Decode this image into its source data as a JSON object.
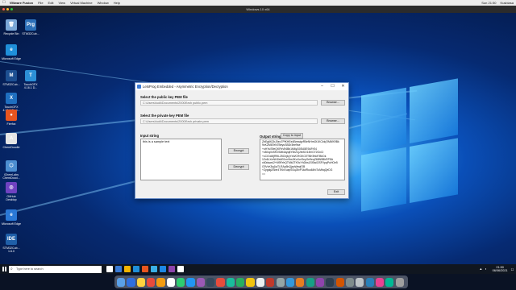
{
  "mac_menubar": {
    "app": "VMware Fusion",
    "menus": [
      "File",
      "Edit",
      "View",
      "Virtual Machine",
      "Window",
      "Help"
    ],
    "status": [
      "Sun 21:50",
      "Kusbiasa"
    ]
  },
  "vm_title": "Windows 10 x64",
  "desktop_icons": [
    {
      "label": "Recycle Bin",
      "glyph": "🗑",
      "color": "#7aa7d6"
    },
    {
      "label": "STM32Cub...",
      "glyph": "Prg",
      "color": "#2c6fb7"
    },
    {
      "label": "Microsoft Edge",
      "glyph": "e",
      "color": "#1f8fd9"
    },
    {
      "label": "STM32Cub...",
      "glyph": "M",
      "color": "#1d4f91"
    },
    {
      "label": "TouchGFX 4.16.1 D...",
      "glyph": "T",
      "color": "#2c8fd6"
    },
    {
      "label": "TouchGFX 4.16.1 Envi...",
      "glyph": "X",
      "color": "#1f6fc0"
    },
    {
      "label": "Firefox",
      "glyph": "●",
      "color": "#e8551f"
    },
    {
      "label": "ChemDoodle",
      "glyph": "A",
      "color": "#e6e6e6"
    },
    {
      "label": "iChemLabs ChemDood...",
      "glyph": "⬡",
      "color": "#4c8ed0"
    },
    {
      "label": "GitHub Desktop",
      "glyph": "◎",
      "color": "#6f42c1"
    },
    {
      "label": "Microsoft Edge",
      "glyph": "e",
      "color": "#2a78d6"
    },
    {
      "label": "STM32Cub... 1.6.0",
      "glyph": "IDE",
      "color": "#1f5fa8"
    }
  ],
  "app": {
    "title": "LetsProg Embedded - Asymmetric Encryption/Decryption",
    "window_controls": [
      "–",
      "☐",
      "✕"
    ],
    "public_key": {
      "label": "Select the public key PEM file",
      "path": "C:\\Users\\kuld\\Documents\\20008\\rsh public.pem",
      "browse": "Browse..."
    },
    "private_key": {
      "label": "Select the private key PEM file",
      "path": "C:\\Users\\kuld\\Documents\\20008\\rsh private.pem",
      "browse": "Browse..."
    },
    "input_label": "Input string",
    "input_value": "this is a sample text",
    "encrypt": "Encrypt",
    "decrypt": "Decrypt",
    "output_label": "Output string",
    "copy_to_input": "Copy to input",
    "output_lines": [
      "ZbEg6KZbJ0eo7PfKHEe4BmwigrR5eNHmOt1KCblq7lM6fX9Bk",
      "9xKZM6TeN7BeyuSBDr3ee9se",
      "+oHYuS9eQKFbVlf4Bb1M6yD0EA5E9AFrE4",
      "+cBXq0xSRJSMt4dyq8YBr2Cj2tbSO1BVO72GnCl",
      "+cCIGxMjR9lL25ChjbyYxWCRGKCETBK9hM7BhDk",
      "1Zc6LXeNHZekE0vnVbs3KoXcrSeyOe9eqZ68N5BhRP5A",
      "x60dswcl2+M99YeQTMb2TK9cYhDbs1Sf3wiOSFVpqPuHOe5",
      "G9VcK5q1iaTLRAp5hQjaoWeqfOB",
      "+Zygdg2Sbe4TKbXuzpSSqJ5vP1kdRuu64hI7uMbqQeDG",
      "=="
    ],
    "exit": "Exit"
  },
  "taskbar": {
    "search_placeholder": "Type here to search",
    "time": "21:50",
    "date": "06/06/2021",
    "icon_colors": [
      "#ffffff",
      "#3a7bd5",
      "#f4b400",
      "#1f8fd9",
      "#e8551f",
      "#3ab0e6",
      "#1e88e5",
      "#8e44ad",
      "#ffffff"
    ]
  },
  "dock": {
    "icon_colors": [
      "#5aa0e8",
      "#2f6fdf",
      "#ffd23f",
      "#e94b3c",
      "#f39c12",
      "#ffffff",
      "#2ecc71",
      "#2196f3",
      "#9b59b6",
      "#34495e",
      "#e74c3c",
      "#1abc9c",
      "#27ae60",
      "#f1c40f",
      "#ecf0f1",
      "#c0392b",
      "#95a5a6",
      "#3498db",
      "#e67e22",
      "#16a085",
      "#8e44ad",
      "#2c3e50",
      "#d35400",
      "#7f8c8d",
      "#bdc3c7",
      "#2980b9",
      "#e84393",
      "#00b894",
      "#a0a0a0"
    ]
  }
}
